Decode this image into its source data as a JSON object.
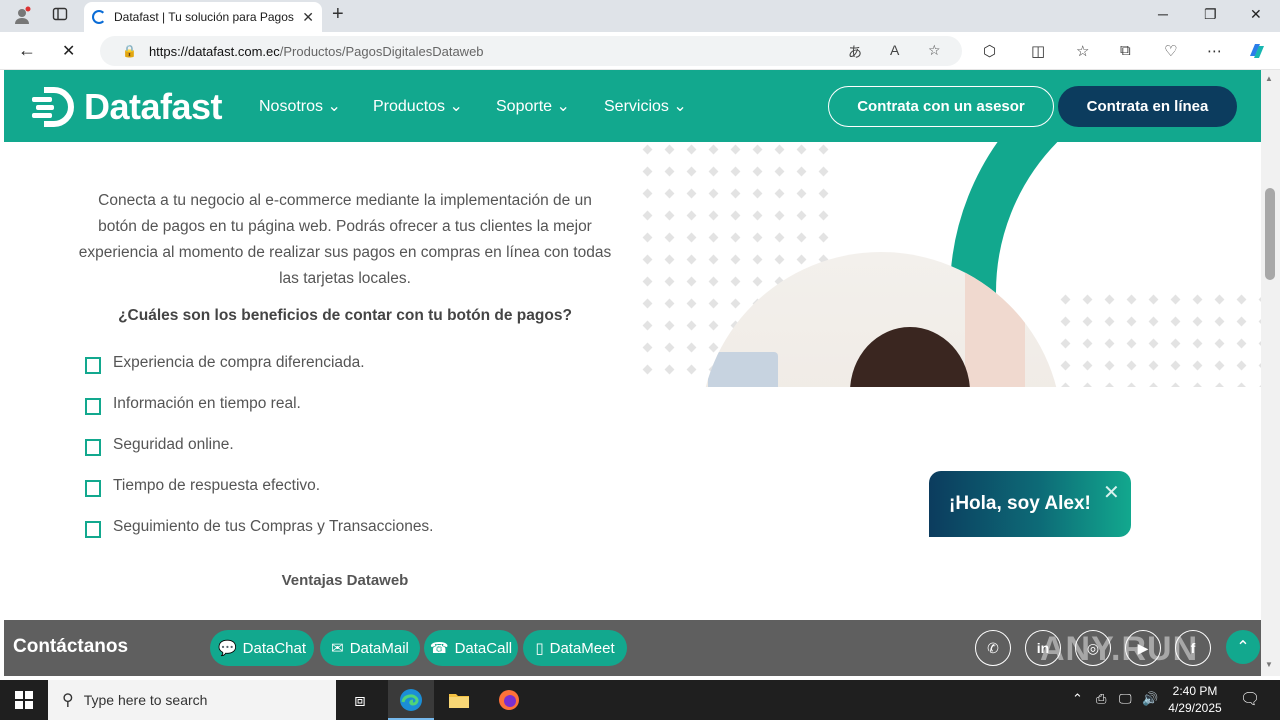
{
  "browser": {
    "tab_title": "Datafast | Tu solución para Pagos",
    "url_host": "https://datafast.com.ec",
    "url_path": "/Productos/PagosDigitalesDataweb"
  },
  "header": {
    "logo": "Datafast",
    "nav": [
      "Nosotros",
      "Productos",
      "Soporte",
      "Servicios"
    ],
    "btn_asesor": "Contrata con un asesor",
    "btn_linea": "Contrata en línea"
  },
  "content": {
    "intro": "Conecta a tu negocio al e-commerce mediante la implementación de un botón de pagos en tu página web. Podrás ofrecer a tus clientes la mejor experiencia al momento de realizar sus pagos en compras en línea con todas las tarjetas locales.",
    "benefits_title": "¿Cuáles son los beneficios de contar con tu botón de pagos?",
    "benefits": [
      "Experiencia de compra diferenciada.",
      "Información en tiempo real.",
      "Seguridad online.",
      "Tiempo de respuesta efectivo.",
      "Seguimiento de tus Compras y Transacciones."
    ],
    "ventajas": "Ventajas Dataweb"
  },
  "chat": {
    "greeting": "¡Hola, soy Alex!"
  },
  "contact": {
    "title": "Contáctanos",
    "pills": [
      "DataChat",
      "DataMail",
      "DataCall",
      "DataMeet"
    ],
    "watermark": "ANY.RUN"
  },
  "taskbar": {
    "search_placeholder": "Type here to search",
    "time": "2:40 PM",
    "date": "4/29/2025"
  },
  "colors": {
    "brand_green": "#12a88e",
    "brand_navy": "#0c3c5e",
    "contact_bar": "#5f5f5f"
  }
}
